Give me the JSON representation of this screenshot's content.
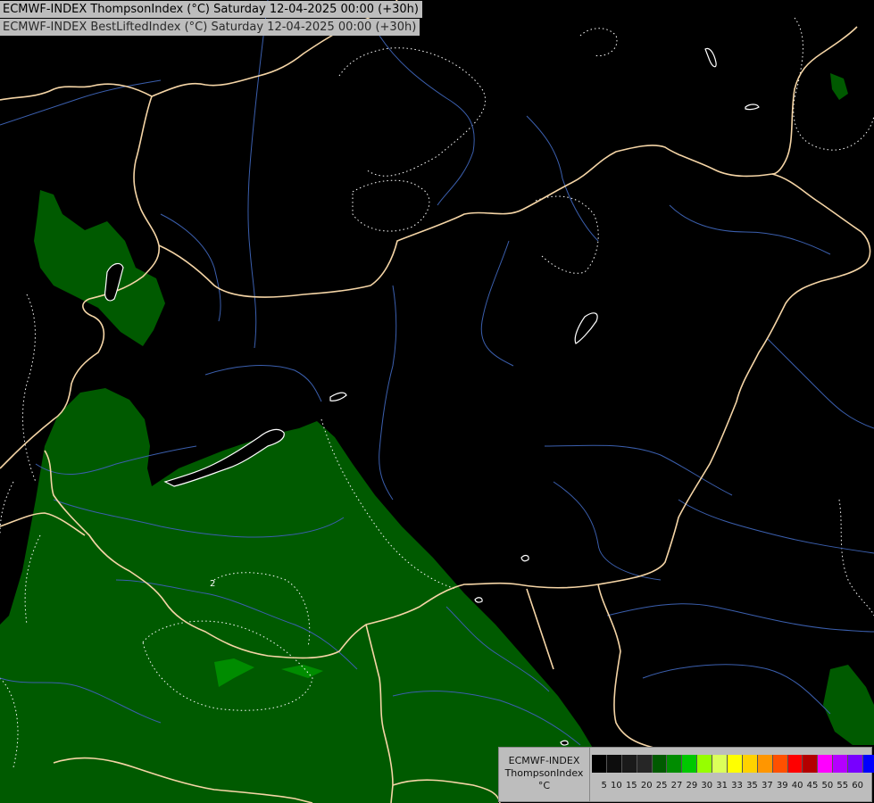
{
  "titles": {
    "line1": "ECMWF-INDEX ThompsonIndex (°C) Saturday 12-04-2025 00:00 (+30h)",
    "line2": "ECMWF-INDEX BestLiftedIndex (°C) Saturday 12-04-2025 00:00 (+30h)"
  },
  "legend": {
    "model": "ECMWF-INDEX",
    "parameter": "ThompsonIndex",
    "unit": "°C",
    "ticks": [
      "5",
      "10",
      "15",
      "20",
      "25",
      "27",
      "29",
      "30",
      "31",
      "33",
      "35",
      "37",
      "39",
      "40",
      "45",
      "50",
      "55",
      "60"
    ],
    "colors": [
      "#000000",
      "#0d0d0d",
      "#1a1a1a",
      "#262626",
      "#005a00",
      "#008c00",
      "#00c800",
      "#96ff00",
      "#dcff5a",
      "#ffff00",
      "#ffd200",
      "#ff9600",
      "#ff5000",
      "#ff0000",
      "#b40000",
      "#ff00ff",
      "#b400ff",
      "#7800ff",
      "#0000ff"
    ]
  },
  "map": {
    "background_color": "#000000",
    "field_colors": {
      "weak": "#005a00",
      "moderate": "#008c00"
    },
    "contour_label": "2",
    "colors": {
      "border": "#f5d5a6",
      "river": "#3b5fae",
      "contour": "#ffffff"
    }
  }
}
